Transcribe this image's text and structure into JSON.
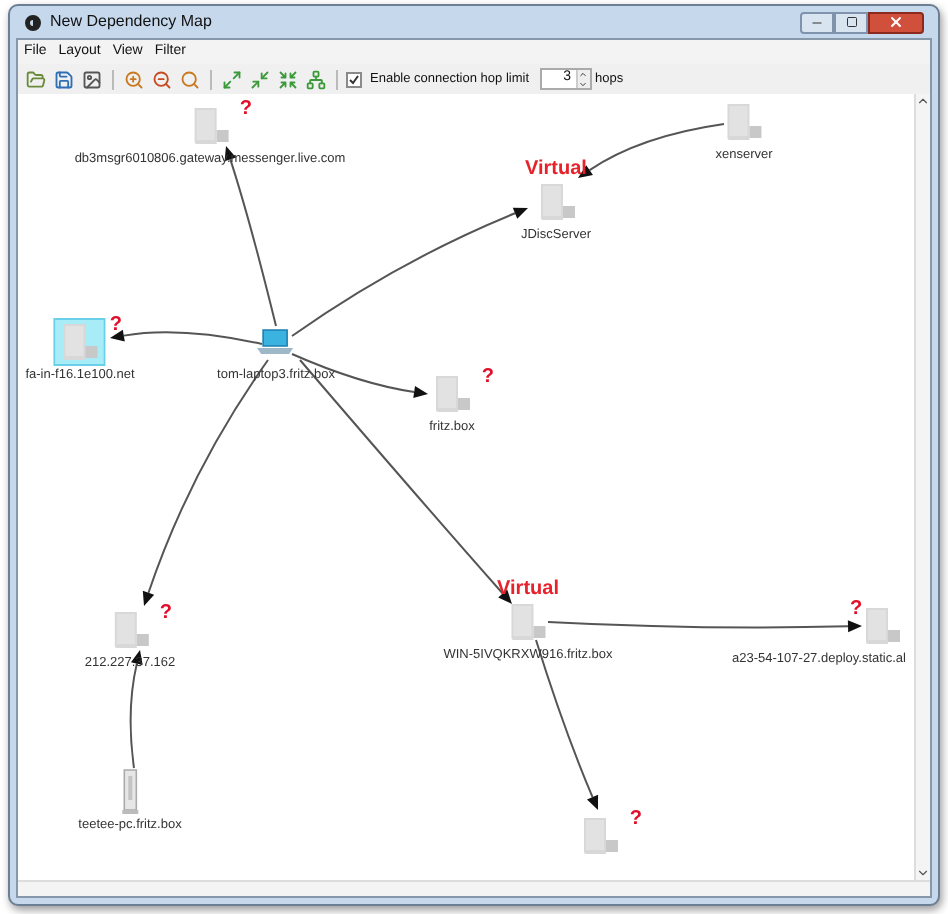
{
  "window": {
    "title": "New Dependency Map"
  },
  "menu": [
    "File",
    "Layout",
    "View",
    "Filter"
  ],
  "toolbar": {
    "hop_limit": {
      "label": "Enable connection hop limit",
      "checked": true,
      "value": "3",
      "unit": "hops"
    }
  },
  "nodes": [
    {
      "kind": "unknown",
      "label": "db3msgr6010806.gateway.messenger.live.com",
      "badge": "?",
      "selected": false
    },
    {
      "kind": "server",
      "label": "xenserver",
      "selected": false
    },
    {
      "kind": "server",
      "label": "JDiscServer",
      "tag": "Virtual",
      "selected": false
    },
    {
      "kind": "unknown",
      "label": "fa-in-f16.1e100.net",
      "badge": "?",
      "selected": true
    },
    {
      "kind": "laptop",
      "label": "tom-laptop3.fritz.box",
      "selected": false
    },
    {
      "kind": "unknown",
      "label": "fritz.box",
      "badge": "?",
      "selected": false
    },
    {
      "kind": "unknown",
      "label": "212.227.37.162",
      "badge": "?",
      "selected": false
    },
    {
      "kind": "server",
      "label": "WIN-5IVQKRXW916.fritz.box",
      "tag": "Virtual",
      "selected": false
    },
    {
      "kind": "unknown",
      "label": "a23-54-107-27.deploy.static.al",
      "badge": "?",
      "selected": false
    },
    {
      "kind": "tower",
      "label": "teetee-pc.fritz.box",
      "selected": false
    },
    {
      "kind": "unknown",
      "badge": "?",
      "selected": false
    }
  ]
}
